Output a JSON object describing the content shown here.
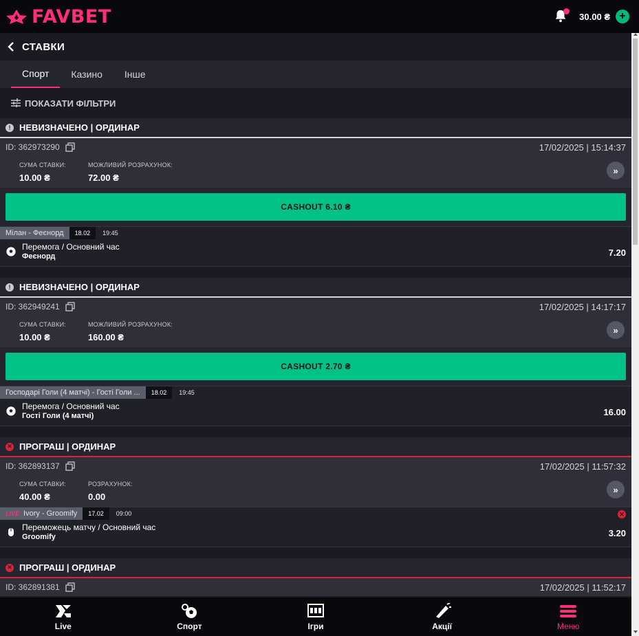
{
  "header": {
    "logo": "FAVBET",
    "balance": "30.00 ₴"
  },
  "page": {
    "title": "СТАВКИ"
  },
  "tabs": [
    "Спорт",
    "Казино",
    "Інше"
  ],
  "filters_label": "ПОКАЗАТИ ФІЛЬТРИ",
  "colors": {
    "accent": "#ff2d7a",
    "cashout": "#00c287",
    "lost": "#e0213b"
  },
  "bets": [
    {
      "status": "НЕВИЗНАЧЕНО | ОРДИНАР",
      "id": "ID: 362973290",
      "date": "17/02/2025 | 15:14:37",
      "stake_label": "СУМА СТАВКИ:",
      "stake": "10.00 ₴",
      "payout_label": "МОЖЛИВИЙ РОЗРАХУНОК:",
      "payout": "72.00 ₴",
      "cashout": "CASHOUT  6.10 ₴",
      "event": {
        "match": "Мілан - Феєнорд",
        "date": "18.02",
        "time": "19:45",
        "market": "Перемога / Основний час",
        "pick": "Феєнорд",
        "odd": "7.20"
      }
    },
    {
      "status": "НЕВИЗНАЧЕНО | ОРДИНАР",
      "id": "ID: 362949241",
      "date": "17/02/2025 | 14:17:17",
      "stake_label": "СУМА СТАВКИ:",
      "stake": "10.00 ₴",
      "payout_label": "МОЖЛИВИЙ РОЗРАХУНОК:",
      "payout": "160.00 ₴",
      "cashout": "CASHOUT  2.70 ₴",
      "event": {
        "match": "Господарі Голи (4 матчі) - Гості Голи ...",
        "date": "18.02",
        "time": "19:45",
        "market": "Перемога / Основний час",
        "pick": "Гості Голи (4 матчі)",
        "odd": "16.00"
      }
    },
    {
      "status": "ПРОГРАШ | ОРДИНАР",
      "id": "ID: 362893137",
      "date": "17/02/2025 | 11:57:32",
      "stake_label": "СУМА СТАВКИ:",
      "stake": "40.00 ₴",
      "payout_label": "РОЗРАХУНОК:",
      "payout": "0.00",
      "event": {
        "live": "LIVE",
        "match": "Ivory - Groomify",
        "date": "17.02",
        "time": "09:00",
        "market": "Переможець матчу / Основний час",
        "pick": "Groomify",
        "odd": "3.20"
      }
    },
    {
      "status": "ПРОГРАШ | ОРДИНАР",
      "id": "ID: 362891381",
      "date": "17/02/2025 | 11:52:17"
    }
  ],
  "nav": [
    "Live",
    "Спорт",
    "Ігри",
    "Акції",
    "Меню"
  ]
}
